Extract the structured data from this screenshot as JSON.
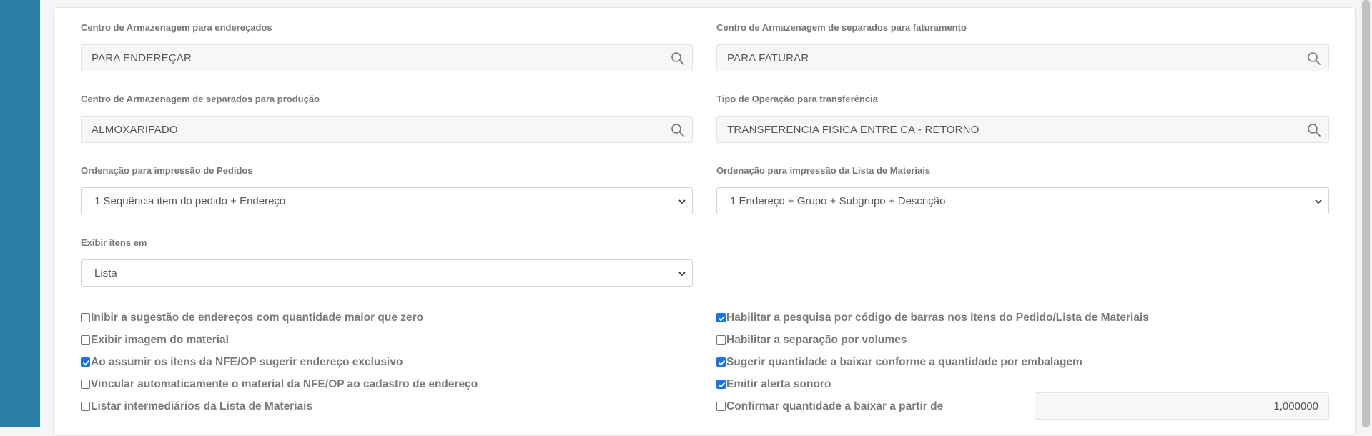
{
  "fields": {
    "ca_enderecados": {
      "label": "Centro de Armazenagem para endereçados",
      "value": "PARA ENDEREÇAR"
    },
    "ca_faturamento": {
      "label": "Centro de Armazenagem de separados para faturamento",
      "value": "PARA FATURAR"
    },
    "ca_producao": {
      "label": "Centro de Armazenagem de separados para produção",
      "value": "ALMOXARIFADO"
    },
    "tipo_operacao": {
      "label": "Tipo de Operação para transferência",
      "value": "TRANSFERENCIA FISICA ENTRE CA - RETORNO"
    },
    "ordenacao_pedidos": {
      "label": "Ordenação para impressão de Pedidos",
      "selected": "1 Sequência item do pedido + Endereço"
    },
    "ordenacao_materiais": {
      "label": "Ordenação para impressão da Lista de Materiais",
      "selected": "1 Endereço + Grupo + Subgrupo + Descrição"
    },
    "exibir_itens": {
      "label": "Exibir itens em",
      "selected": "Lista"
    }
  },
  "checkboxes_left": [
    {
      "label": "Inibir a sugestão de endereços com quantidade maior que zero",
      "checked": false
    },
    {
      "label": "Exibir imagem do material",
      "checked": false
    },
    {
      "label": "Ao assumir os itens da NFE/OP sugerir endereço exclusivo",
      "checked": true
    },
    {
      "label": "Vincular automaticamente o material da NFE/OP ao cadastro de endereço",
      "checked": false
    },
    {
      "label": "Listar intermediários da Lista de Materiais",
      "checked": false
    }
  ],
  "checkboxes_right": [
    {
      "label": "Habilitar a pesquisa por código de barras nos itens do Pedido/Lista de Materiais",
      "checked": true
    },
    {
      "label": "Habilitar a separação por volumes",
      "checked": false
    },
    {
      "label": "Sugerir quantidade a baixar conforme a quantidade por embalagem",
      "checked": true
    },
    {
      "label": "Emitir alerta sonoro",
      "checked": true
    },
    {
      "label": "Confirmar quantidade a baixar a partir de",
      "checked": false
    }
  ],
  "confirmar_quantidade_value": "1,000000",
  "colors": {
    "sidebar": "#2b7ea6",
    "checkbox_accent": "#1a73e8"
  },
  "icons": {
    "lookup": "search-icon",
    "select": "chevron-down-icon"
  }
}
